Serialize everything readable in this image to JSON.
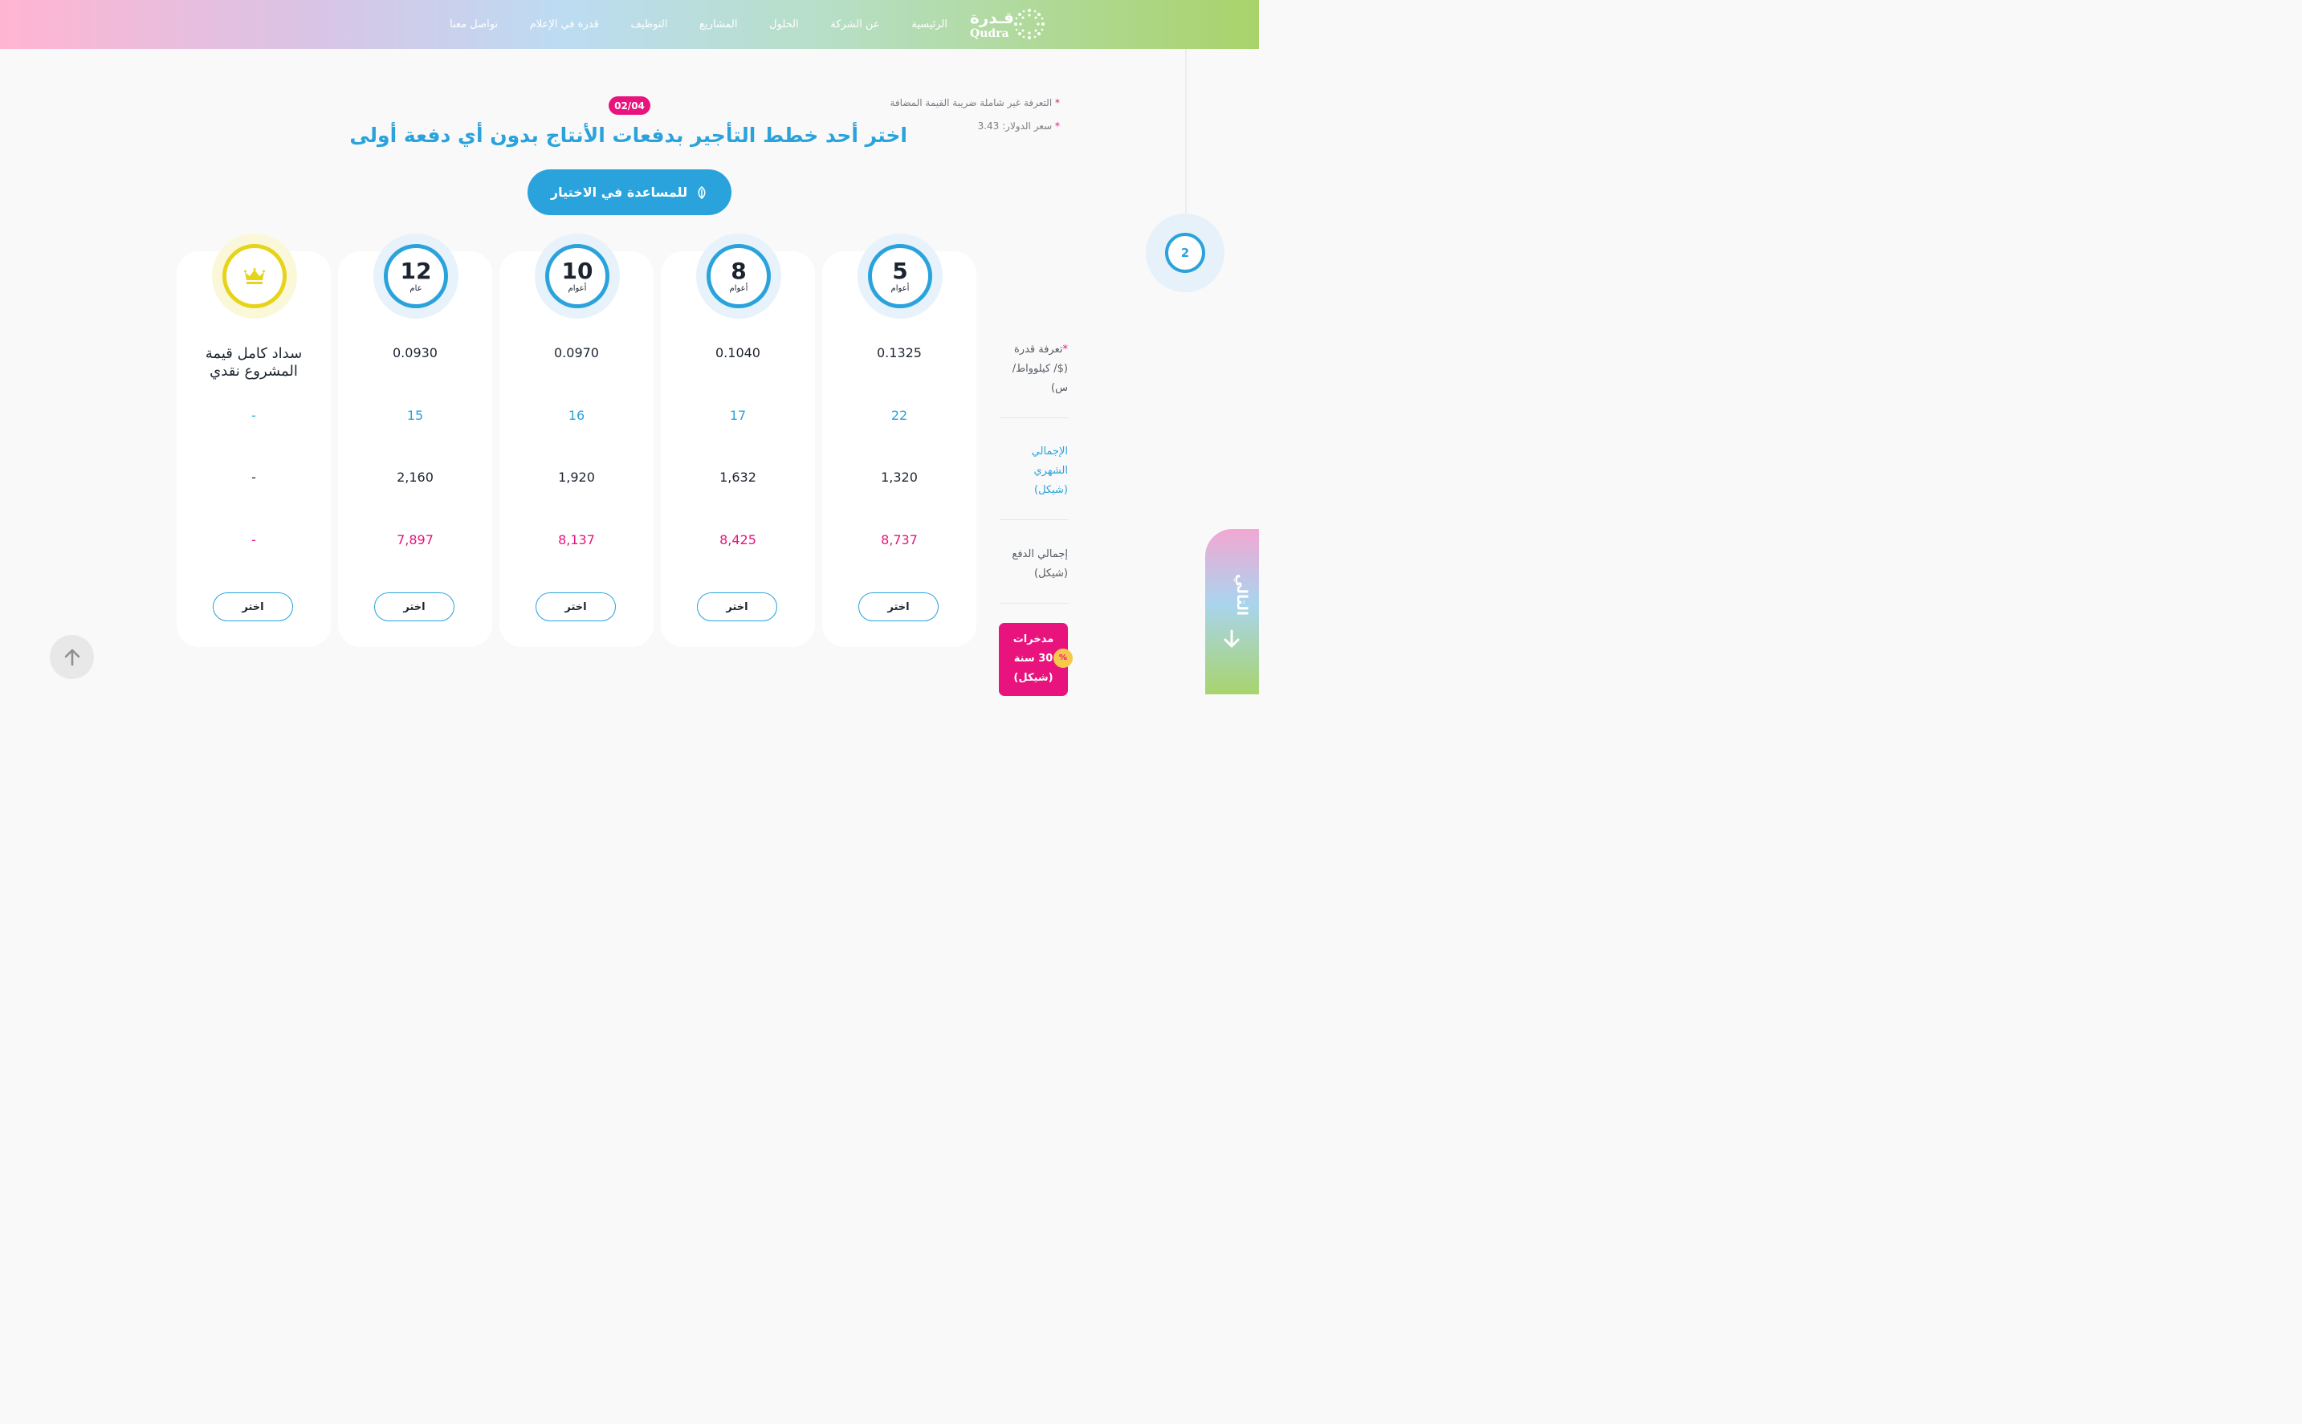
{
  "nav": {
    "items": [
      "الرئيسية",
      "عن الشركة",
      "الحلول",
      "المشاريع",
      "التوظيف",
      "قدرة في الإعلام",
      "تواصل معنا"
    ]
  },
  "logo": {
    "arabic": "قـدرة",
    "latin": "Qudra"
  },
  "step": {
    "current": "2",
    "counter": "02/04"
  },
  "notes": {
    "vat": "التعرفة غير شاملة ضريبة القيمة المضافة",
    "dollar": "سعر الدولار: 3.43"
  },
  "title": "اختر أحد خطط التأجير بدفعات الأنتاج بدون أي دفعة أولى",
  "help_button": "للمساعدة في الاختيار",
  "row_labels": {
    "tariff": "تعرفة قدرة ($/ كيلوواط/ س)",
    "monthly": "الإجمالي الشهري (شيكل)",
    "total": "إجمالي الدفع (شيكل)",
    "savings_line1": "مدخرات",
    "savings_line2": "30 سنة",
    "savings_line3": "(شيكل)",
    "percent": "%"
  },
  "plans": [
    {
      "years": "5",
      "unit": "أعوام",
      "tariff": "0.1325",
      "monthly": "22",
      "total": "1,320",
      "savings": "8,737",
      "button": "اختر"
    },
    {
      "years": "8",
      "unit": "أعوام",
      "tariff": "0.1040",
      "monthly": "17",
      "total": "1,632",
      "savings": "8,425",
      "button": "اختر"
    },
    {
      "years": "10",
      "unit": "أعوام",
      "tariff": "0.0970",
      "monthly": "16",
      "total": "1,920",
      "savings": "8,137",
      "button": "اختر"
    },
    {
      "years": "12",
      "unit": "عام",
      "tariff": "0.0930",
      "monthly": "15",
      "total": "2,160",
      "savings": "7,897",
      "button": "اختر"
    },
    {
      "label": "سداد كامل قيمة المشروع نقدي",
      "monthly": "-",
      "total": "-",
      "savings": "-",
      "button": "اختر"
    }
  ],
  "next_tab": "التالي",
  "colors": {
    "blue": "#2aa3dc",
    "pink": "#e8137d",
    "gold": "#e6d31a"
  }
}
